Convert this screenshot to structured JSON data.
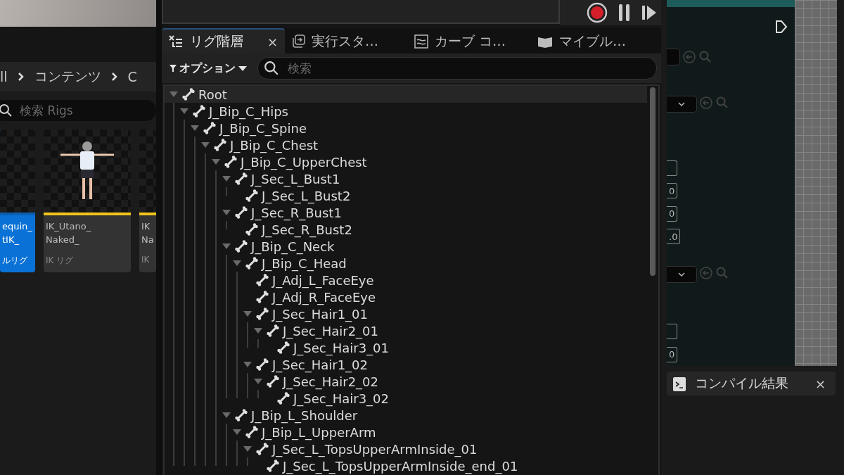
{
  "content_browser": {
    "breadcrumb": [
      "ll",
      "コンテンツ",
      "C"
    ],
    "search": {
      "placeholder": "検索 Rigs"
    },
    "assets": [
      {
        "name": "equin_\ntIK_",
        "type": "ルリグ",
        "selected": true
      },
      {
        "name": "IK_Utano_\nNaked_",
        "type": "IK リグ",
        "selected": false
      },
      {
        "name": "IK\nNa",
        "type": "IK",
        "selected": false
      }
    ]
  },
  "tabs": [
    {
      "label": "リグ階層",
      "selected": true,
      "close": "×"
    },
    {
      "label": "実行スタ…",
      "selected": false
    },
    {
      "label": "カーブ コ…",
      "selected": false
    },
    {
      "label": "マイブル…",
      "selected": false
    }
  ],
  "toolbar": {
    "options": "オプション",
    "search": {
      "placeholder": "検索"
    }
  },
  "tree": [
    {
      "name": "Root",
      "selected": true,
      "expanded": true,
      "children": [
        {
          "name": "J_Bip_C_Hips",
          "selected": false,
          "expanded": true,
          "children": [
            {
              "name": "J_Bip_C_Spine",
              "selected": false,
              "expanded": true,
              "children": [
                {
                  "name": "J_Bip_C_Chest",
                  "selected": false,
                  "expanded": true,
                  "children": [
                    {
                      "name": "J_Bip_C_UpperChest",
                      "selected": false,
                      "expanded": true,
                      "children": [
                        {
                          "name": "J_Sec_L_Bust1",
                          "selected": false,
                          "expanded": true,
                          "children": [
                            {
                              "name": "J_Sec_L_Bust2",
                              "selected": false
                            }
                          ]
                        },
                        {
                          "name": "J_Sec_R_Bust1",
                          "selected": false,
                          "expanded": true,
                          "children": [
                            {
                              "name": "J_Sec_R_Bust2",
                              "selected": false
                            }
                          ]
                        },
                        {
                          "name": "J_Bip_C_Neck",
                          "selected": false,
                          "expanded": true,
                          "children": [
                            {
                              "name": "J_Bip_C_Head",
                              "selected": false,
                              "expanded": true,
                              "children": [
                                {
                                  "name": "J_Adj_L_FaceEye",
                                  "selected": false
                                },
                                {
                                  "name": "J_Adj_R_FaceEye",
                                  "selected": false
                                },
                                {
                                  "name": "J_Sec_Hair1_01",
                                  "selected": false,
                                  "expanded": true,
                                  "children": [
                                    {
                                      "name": "J_Sec_Hair2_01",
                                      "selected": false,
                                      "expanded": true,
                                      "children": [
                                        {
                                          "name": "J_Sec_Hair3_01",
                                          "selected": false
                                        }
                                      ]
                                    }
                                  ]
                                },
                                {
                                  "name": "J_Sec_Hair1_02",
                                  "selected": false,
                                  "expanded": true,
                                  "children": [
                                    {
                                      "name": "J_Sec_Hair2_02",
                                      "selected": false,
                                      "expanded": true,
                                      "children": [
                                        {
                                          "name": "J_Sec_Hair3_02",
                                          "selected": false
                                        }
                                      ]
                                    }
                                  ]
                                }
                              ]
                            }
                          ]
                        },
                        {
                          "name": "J_Bip_L_Shoulder",
                          "selected": false,
                          "expanded": true,
                          "children": [
                            {
                              "name": "J_Bip_L_UpperArm",
                              "selected": false,
                              "expanded": true,
                              "children": [
                                {
                                  "name": "J_Sec_L_TopsUpperArmInside_01",
                                  "selected": false,
                                  "expanded": true,
                                  "children": [
                                    {
                                      "name": "J_Sec_L_TopsUpperArmInside_end_01",
                                      "selected": false
                                    }
                                  ]
                                }
                              ]
                            }
                          ]
                        }
                      ]
                    }
                  ]
                }
              ]
            }
          ]
        }
      ]
    }
  ],
  "details": {
    "rows": [
      {
        "kind": "picker"
      },
      {
        "kind": "dropdown"
      },
      {
        "kind": "field"
      },
      {
        "kind": "field",
        "value": "0"
      },
      {
        "kind": "field",
        "value": "0"
      },
      {
        "kind": "field",
        "value": ".0"
      },
      {
        "kind": "dropdown"
      },
      {
        "kind": "field"
      },
      {
        "kind": "field",
        "value": "0"
      }
    ]
  },
  "compile_tab": {
    "label": "コンパイル結果",
    "close": "×"
  }
}
